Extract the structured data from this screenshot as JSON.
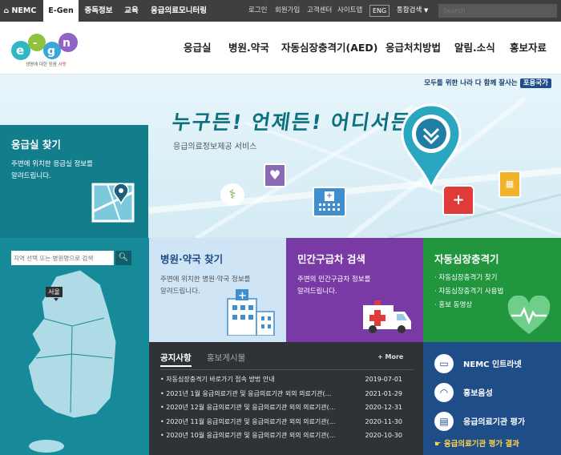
{
  "topbar": {
    "tabs": [
      {
        "icon": "home-icon",
        "label": "NEMC"
      },
      {
        "label": "E-Gen"
      },
      {
        "label": "중독정보"
      },
      {
        "label": "교육"
      },
      {
        "label": "응급의료모니터링"
      }
    ],
    "utilities": [
      "로그인",
      "회원가입",
      "고객센터",
      "사이트맵"
    ],
    "lang": "ENG",
    "search_scope": "통합검색",
    "search_placeholder": "Search"
  },
  "header": {
    "logo_text": "e-gen",
    "logo_slogan_prefix": "생명에 대한 믿음",
    "logo_slogan_accent": "사랑",
    "nav": [
      "응급실",
      "병원.약국",
      "자동심장충격기(AED)",
      "응급처치방법",
      "알림.소식",
      "홍보자료"
    ]
  },
  "hero": {
    "slogan": "모두를 위한 나라 다 함께 잘사는",
    "slogan_badge": "포용국가",
    "headline": "누구든! 언제든! 어디서든!",
    "subtitle": "응급의료정보제공 서비스"
  },
  "er_find": {
    "title": "응급실 찾기",
    "desc1": "주변에 위치한 응급실 정보를",
    "desc2": "알려드립니다.",
    "search_placeholder": "지역 선택 또는 병원명으로 검색",
    "map_label": "서울"
  },
  "hospital": {
    "title": "병원·약국 찾기",
    "desc1": "주변에 위치한 병원·약국 정보를",
    "desc2": "알려드립니다."
  },
  "ambulance": {
    "title": "민간구급차 검색",
    "desc1": "주변의 민간구급차 정보를",
    "desc2": "알려드립니다."
  },
  "aed": {
    "title": "자동심장충격기",
    "items": [
      "자동심장충격기 찾기",
      "자동심장충격기 사용법",
      "홍보 동영상"
    ]
  },
  "notice": {
    "tab_active": "공지사항",
    "tab_inactive": "홍보게시물",
    "more": "+ More",
    "items": [
      {
        "title": "자동심장충격기 바로가기 접속 방법 안내",
        "date": "2019-07-01"
      },
      {
        "title": "2021년 1월 응급의료기관 및 응급의료기관 외의 의료기관(...",
        "date": "2021-01-29"
      },
      {
        "title": "2020년 12월 응급의료기관 및 응급의료기관 외의 의료기관(...",
        "date": "2020-12-31"
      },
      {
        "title": "2020년 11월 응급의료기관 및 응급의료기관 외의 의료기관(...",
        "date": "2020-11-30"
      },
      {
        "title": "2020년 10월 응급의료기관 및 응급의료기관 외의 의료기관(...",
        "date": "2020-10-30"
      }
    ]
  },
  "quicklinks": {
    "items": [
      {
        "icon": "monitor-icon",
        "label": "NEMC 인트라넷"
      },
      {
        "icon": "headphones-icon",
        "label": "홍보음성"
      },
      {
        "icon": "report-icon",
        "label": "응급의료기관 평가"
      }
    ],
    "result_link": "응급의료기관 평가 결과"
  },
  "colors": {
    "teal": "#127e8c",
    "purple": "#7a3aa6",
    "green": "#22963f",
    "navy": "#1e4d88",
    "dark": "#2f3338"
  }
}
